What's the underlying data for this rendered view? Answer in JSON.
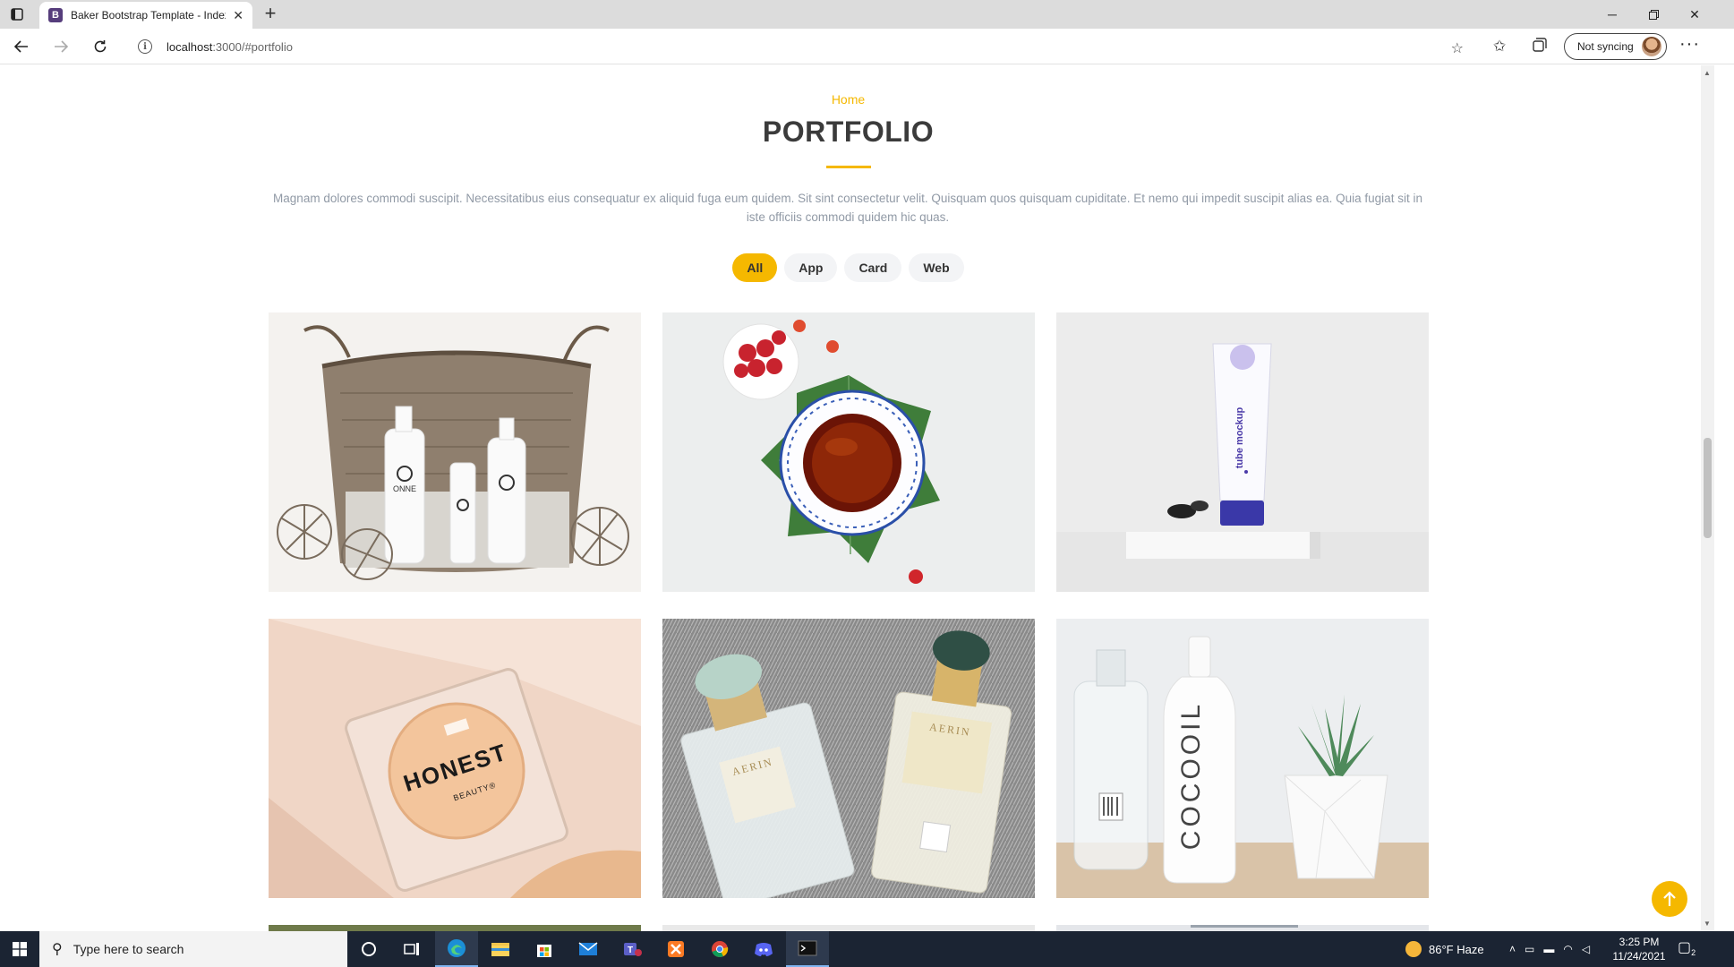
{
  "browser": {
    "tab_title": "Baker Bootstrap Template - Index",
    "tab_favicon": "B",
    "url_host": "localhost",
    "url_path": ":3000/#portfolio",
    "sync_label": "Not syncing"
  },
  "page": {
    "breadcrumb": "Home",
    "title": "PORTFOLIO",
    "lead": "Magnam dolores commodi suscipit. Necessitatibus eius consequatur ex aliquid fuga eum quidem. Sit sint consectetur velit. Quisquam quos quisquam cupiditate. Et nemo qui impedit suscipit alias ea. Quia fugiat sit in iste officiis commodi quidem hic quas.",
    "filters": [
      {
        "label": "All",
        "active": true
      },
      {
        "label": "App",
        "active": false
      },
      {
        "label": "Card",
        "active": false
      },
      {
        "label": "Web",
        "active": false
      }
    ],
    "portfolio_items": [
      {
        "subject": "basket-with-bottles",
        "bottle_brand": "ONNE"
      },
      {
        "subject": "tea-cup-with-raspberries"
      },
      {
        "subject": "tube-mockup",
        "tube_text": "tube mockup"
      },
      {
        "subject": "honest-beauty-compact",
        "brand": "HONEST",
        "brand_sub": "BEAUTY®"
      },
      {
        "subject": "aerin-perfume-bottles",
        "brand": "AERIN"
      },
      {
        "subject": "cocooil-bottle-and-succulent",
        "brand": "COCOOIL"
      }
    ],
    "accent_color": "#f5b800"
  },
  "taskbar": {
    "search_placeholder": "Type here to search",
    "weather": "86°F  Haze",
    "time": "3:25 PM",
    "date": "11/24/2021",
    "notification_count": "2"
  }
}
